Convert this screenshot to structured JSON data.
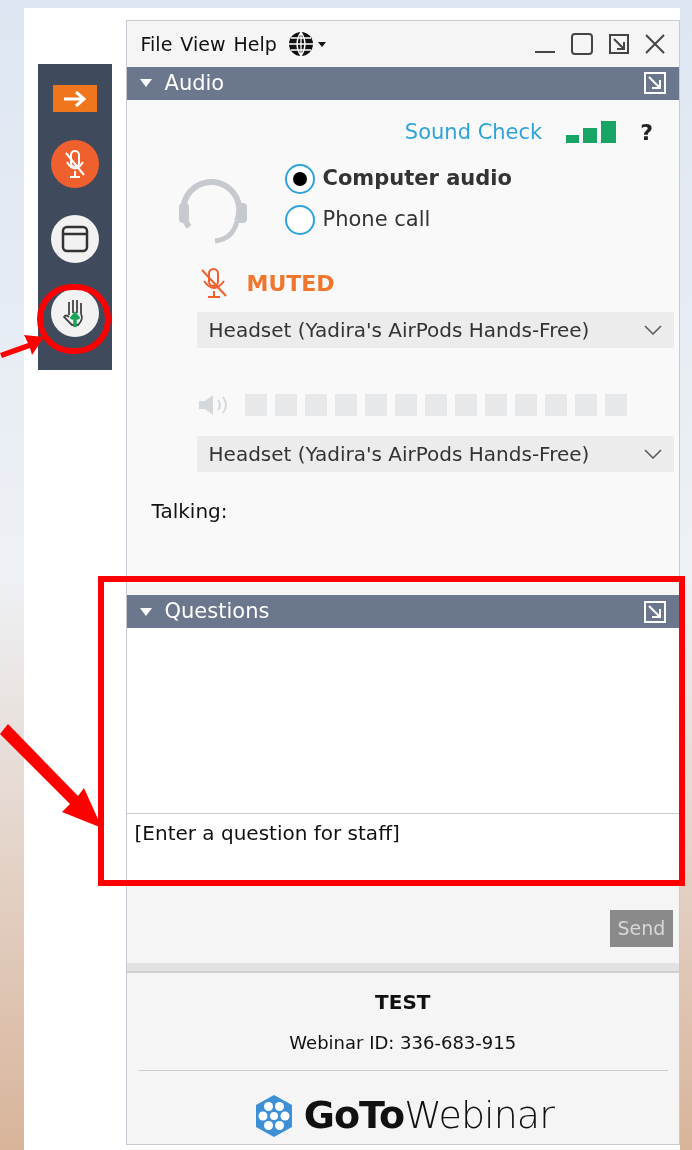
{
  "menu": [
    "File",
    "View",
    "Help"
  ],
  "sidebar": {
    "muted": true
  },
  "audio": {
    "title": "Audio",
    "expanded": true,
    "sound_check": "Sound Check",
    "help": "?",
    "options": [
      {
        "label": "Computer audio",
        "selected": true
      },
      {
        "label": "Phone call",
        "selected": false
      }
    ],
    "muted": true,
    "muted_label": "MUTED",
    "microphone": "Headset (Yadira's AirPods Hands-Free)",
    "speaker": "Headset (Yadira's AirPods Hands-Free)",
    "talking": "Talking:"
  },
  "questions": {
    "title": "Questions",
    "expanded": true,
    "placeholder": "[Enter a question for staff]",
    "send": "Send"
  },
  "footer": {
    "title": "TEST",
    "webinar_id": "Webinar ID: 336-683-915",
    "logo": "**GoTo**Webinar"
  }
}
